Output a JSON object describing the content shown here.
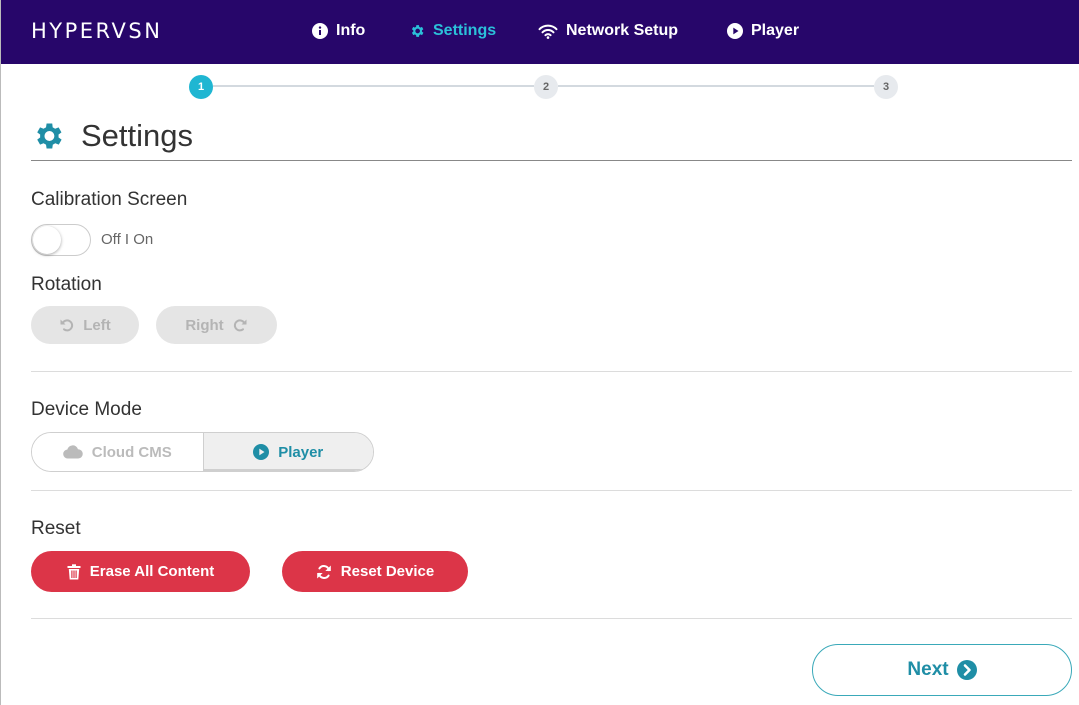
{
  "nav": {
    "brand": "HYPERVSN",
    "items": [
      {
        "label": "Info",
        "icon": "info-circle-icon",
        "active": false
      },
      {
        "label": "Settings",
        "icon": "gear-icon",
        "active": true
      },
      {
        "label": "Network Setup",
        "icon": "wifi-icon",
        "active": false
      },
      {
        "label": "Player",
        "icon": "play-circle-icon",
        "active": false
      }
    ]
  },
  "stepper": {
    "steps": [
      "1",
      "2",
      "3"
    ],
    "current": 1
  },
  "page": {
    "title": "Settings",
    "title_icon": "gear-icon"
  },
  "calibration": {
    "label": "Calibration Screen",
    "toggle_text": "Off I On",
    "enabled": false
  },
  "rotation": {
    "label": "Rotation",
    "left_label": "Left",
    "right_label": "Right"
  },
  "device_mode": {
    "label": "Device Mode",
    "options": [
      "Cloud CMS",
      "Player"
    ],
    "selected": "Player"
  },
  "reset": {
    "label": "Reset",
    "erase_label": "Erase All Content",
    "reset_label": "Reset Device"
  },
  "footer": {
    "next_label": "Next"
  },
  "colors": {
    "nav_bg": "#27066a",
    "accent": "#1fb6d2",
    "danger": "#dc3548",
    "teal_text": "#1f8ea6"
  }
}
